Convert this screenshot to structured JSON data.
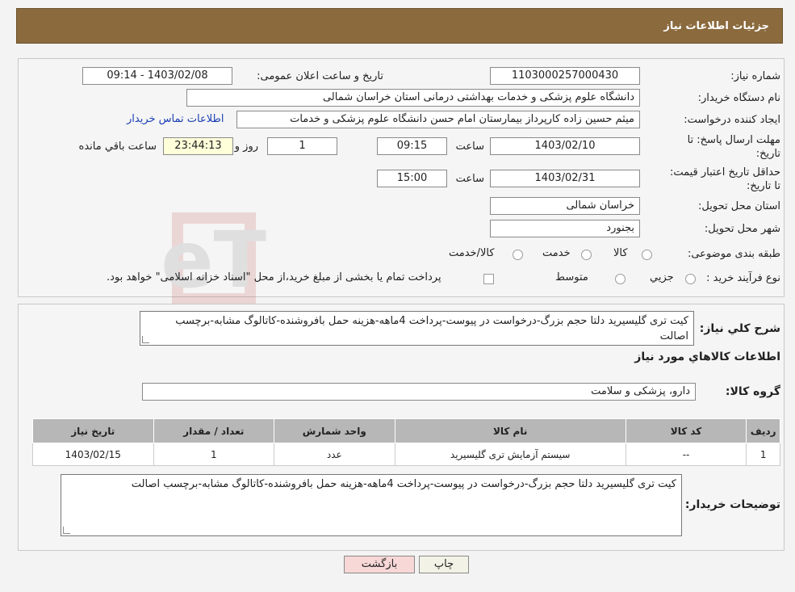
{
  "header": {
    "title": "جزئیات اطلاعات نیاز"
  },
  "form": {
    "need_number_label": "شماره نیاز:",
    "need_number": "1103000257000430",
    "announce_label": "تاریخ و ساعت اعلان عمومی:",
    "announce_value": "1403/02/08 - 09:14",
    "buyer_org_label": "نام دستگاه خریدار:",
    "buyer_org": "دانشگاه علوم پزشکی و خدمات بهداشتی درمانی استان خراسان شمالی",
    "creator_label": "ایجاد کننده درخواست:",
    "creator": "میثم حسین زاده کارپرداز بیمارستان امام حسن دانشگاه علوم پزشکی و خدمات",
    "contact_link": "اطلاعات تماس خریدار",
    "reply_deadline_label": "مهلت ارسال پاسخ: تا تاریخ:",
    "reply_date": "1403/02/10",
    "time_label": "ساعت",
    "reply_time": "09:15",
    "days_value": "1",
    "days_label": "روز و",
    "remaining_value": "23:44:13",
    "remaining_label": "ساعت باقي مانده",
    "price_validity_label": "حداقل تاريخ اعتبار قيمت: تا تاریخ:",
    "price_date": "1403/02/31",
    "price_time": "15:00",
    "province_label": "استان محل تحویل:",
    "province": "خراسان شمالی",
    "city_label": "شهر محل تحویل:",
    "city": "بجنورد",
    "category_label": "طبقه بندی موضوعی:",
    "category_options": [
      "کالا",
      "خدمت",
      "کالا/خدمت"
    ],
    "process_label": "نوع فرآیند خرید :",
    "process_options": [
      "جزيي",
      "متوسط"
    ],
    "process_note": "پرداخت تمام یا بخشی از مبلغ خرید،از محل \"اسناد خزانه اسلامی\" خواهد بود."
  },
  "details": {
    "summary_label": "شرح کلي نياز:",
    "summary": "کیت تری گلیسیرید دلتا حجم بزرگ-درخواست در پیوست-پرداخت 4ماهه-هزینه حمل بافروشنده-کاتالوگ مشابه-برچسب اصالت",
    "goods_info_title": "اطلاعات کالاهاي مورد نياز",
    "goods_group_label": "گروه کالا:",
    "goods_group": "دارو، پزشکی و سلامت",
    "table": {
      "headers": [
        "رديف",
        "کد کالا",
        "نام کالا",
        "واحد شمارش",
        "تعداد / مقدار",
        "تاریخ نیاز"
      ],
      "rows": [
        [
          "1",
          "--",
          "سیستم آزمایش تری گلیسیرید",
          "عدد",
          "1",
          "1403/02/15"
        ]
      ]
    },
    "buyer_notes_label": "توضیحات خریدار:",
    "buyer_notes": "کیت تری گلیسیرید دلتا حجم بزرگ-درخواست در پیوست-پرداخت 4ماهه-هزینه حمل بافروشنده-کاتالوگ مشابه-برچسب اصالت"
  },
  "buttons": {
    "print": "چاپ",
    "back": "بازگشت"
  },
  "watermark_text": "AriaTender.neT",
  "colors": {
    "header": "#8b6a3e",
    "link": "#1a3fb3",
    "back_button": "#f8d7d7",
    "print_button": "#f2f2e6"
  }
}
